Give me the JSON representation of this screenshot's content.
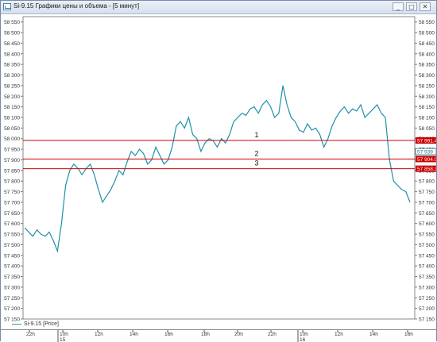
{
  "window": {
    "title": "Si-9.15 Графики цены и объема - [5 минут]",
    "min_label": "_",
    "max_label": "□",
    "close_label": "✕"
  },
  "legend": {
    "label": "Si-9.15 [Price]",
    "color": "#2a9bb0"
  },
  "colors": {
    "line": "#1e90a8",
    "level": "#cc0000",
    "grid": "#c8c8c8"
  },
  "chart_data": {
    "type": "line",
    "y_ticks": [
      "58 550",
      "58 500",
      "58 450",
      "58 400",
      "58 350",
      "58 300",
      "58 250",
      "58 200",
      "58 150",
      "58 100",
      "58 050",
      "58 000",
      "57 950",
      "57 900",
      "57 850",
      "57 800",
      "57 750",
      "57 700",
      "57 650",
      "57 600",
      "57 550",
      "57 500",
      "57 450",
      "57 400",
      "57 350",
      "57 300",
      "57 250",
      "57 200",
      "57 150"
    ],
    "ylim": [
      57150,
      58575
    ],
    "x_ticks": [
      "22h",
      "10h",
      "12h",
      "14h",
      "16h",
      "18h",
      "20h",
      "22h",
      "10h",
      "12h",
      "14h",
      "16h"
    ],
    "x_days": [
      "15",
      "16"
    ],
    "price_labels": [
      "57 991.4",
      "57 939",
      "57 904.0",
      "57 858.3"
    ],
    "levels": [
      {
        "label": "1",
        "value": 57991.4
      },
      {
        "label": "2",
        "value": 57904.0
      },
      {
        "label": "3",
        "value": 57858.3
      }
    ],
    "last_price": 57939,
    "series": [
      {
        "values": [
          57580,
          57560,
          57540,
          57570,
          57550,
          57540,
          57560,
          57520,
          57470,
          57600,
          57780,
          57850,
          57880,
          57860,
          57830,
          57860,
          57880,
          57830,
          57760,
          57700,
          57730,
          57760,
          57800,
          57850,
          57830,
          57890,
          57940,
          57920,
          57950,
          57930,
          57880,
          57900,
          57960,
          57920,
          57880,
          57900,
          57960,
          58060,
          58080,
          58050,
          58100,
          58020,
          58000,
          57940,
          57980,
          58000,
          57990,
          57960,
          58000,
          57980,
          58020,
          58080,
          58100,
          58120,
          58110,
          58140,
          58150,
          58120,
          58160,
          58180,
          58150,
          58100,
          58120,
          58250,
          58160,
          58100,
          58080,
          58040,
          58030,
          58070,
          58040,
          58050,
          58020,
          57960,
          58000,
          58060,
          58100,
          58130,
          58150,
          58120,
          58140,
          58130,
          58160,
          58100,
          58120,
          58140,
          58160,
          58120,
          58100,
          57900,
          57800,
          57780,
          57760,
          57750,
          57700
        ]
      }
    ]
  }
}
